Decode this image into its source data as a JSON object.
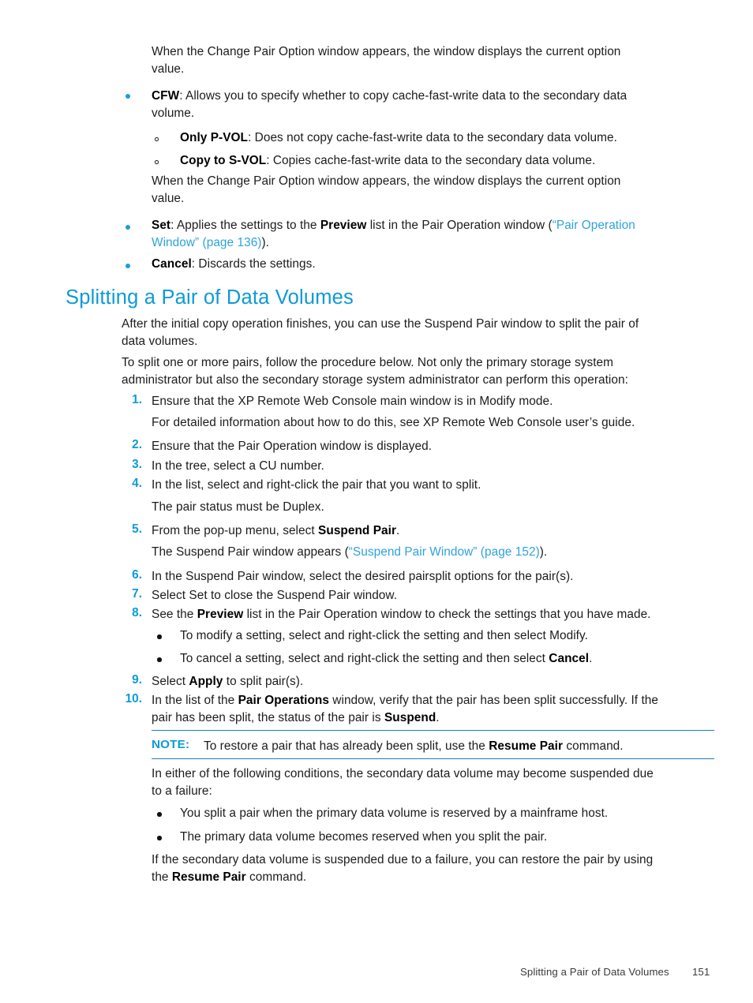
{
  "page": {
    "number": "151",
    "footer_title": "Splitting a Pair of Data Volumes"
  },
  "intro": {
    "para1_line1": "When the Change Pair Option window appears, the window displays the current option",
    "para1_line2": "value."
  },
  "option_bullets": [
    {
      "term": "CFW",
      "rest_line1": ": Allows you to specify whether to copy cache-fast-write data to the secondary data",
      "rest_line2": "volume."
    }
  ],
  "sub_bullets": [
    {
      "term": "Only P-VOL",
      "rest": ": Does not copy cache-fast-write data to the secondary data volume."
    },
    {
      "term": "Copy to S-VOL",
      "rest": ": Copies cache-fast-write data to the secondary data volume."
    }
  ],
  "intro2": {
    "line1": "When the Change Pair Option window appears, the window displays the current option",
    "line2": "value."
  },
  "set_bullet": {
    "term": "Set",
    "part1": ": Applies the settings to the ",
    "bold2": "Preview",
    "part2": " list in the Pair Operation window (",
    "link_line1": "“Pair Operation",
    "link_line2": "Window” (page 136)",
    "tail": ")."
  },
  "cancel_bullet": {
    "term": "Cancel",
    "rest": ": Discards the settings."
  },
  "heading": "Splitting a Pair of Data Volumes",
  "section_intro": {
    "p1_line1": "After the initial copy operation finishes, you can use the Suspend Pair window to split the pair of",
    "p1_line2": "data volumes.",
    "p2_line1": "To split one or more pairs, follow the procedure below. Not only the primary storage system",
    "p2_line2": "administrator but also the secondary storage system administrator can perform this operation:"
  },
  "steps": [
    {
      "num": "1.",
      "text": "Ensure that the XP Remote Web Console main window is in Modify mode.",
      "sub_text": "For detailed information about how to do this, see XP Remote Web Console user’s guide."
    },
    {
      "num": "2.",
      "text": "Ensure that the Pair Operation window is displayed."
    },
    {
      "num": "3.",
      "text": "In the tree, select a CU number."
    },
    {
      "num": "4.",
      "text": "In the list, select and right-click the pair that you want to split.",
      "sub_text": "The pair status must be Duplex."
    },
    {
      "num": "5.",
      "text_pre": "From the pop-up menu, select ",
      "text_bold": "Suspend Pair",
      "text_post": ".",
      "sub_pre": "The Suspend Pair window appears (",
      "sub_link": "“Suspend Pair Window” (page 152)",
      "sub_post": ")."
    },
    {
      "num": "6.",
      "text": "In the Suspend Pair window, select the desired pairsplit options for the pair(s)."
    },
    {
      "num": "7.",
      "text": "Select Set to close the Suspend Pair window."
    },
    {
      "num": "8.",
      "text_pre": "See the ",
      "text_bold": "Preview",
      "text_post": " list in the Pair Operation window to check the settings that you have made."
    },
    {
      "num": "9.",
      "text_pre": "Select ",
      "text_bold": "Apply",
      "text_post": " to split pair(s)."
    },
    {
      "num": "10.",
      "line1_pre": "In the list of the ",
      "line1_bold": "Pair Operations",
      "line1_post": " window, verify that the pair has been split successfully. If the",
      "line2_pre": "pair has been split, the status of the pair is ",
      "line2_bold": "Suspend",
      "line2_post": "."
    }
  ],
  "step8_bullets": [
    {
      "text": "To modify a setting, select and right-click the setting and then select Modify."
    },
    {
      "text_pre": "To cancel a setting, select and right-click the setting and then select ",
      "text_bold": "Cancel",
      "text_post": "."
    }
  ],
  "note": {
    "label": "NOTE:",
    "text_pre": "To restore a pair that has already been split, use the ",
    "text_bold": "Resume Pair",
    "text_post": " command."
  },
  "closing": {
    "p1_line1": "In either of the following conditions, the secondary data volume may become suspended due",
    "p1_line2": "to a failure:",
    "bullets": [
      "You split a pair when the primary data volume is reserved by a mainframe host.",
      "The primary data volume becomes reserved when you split the pair."
    ],
    "p2_line1": "If the secondary data volume is suspended due to a failure, you can restore the pair by using",
    "p2_pre": "the ",
    "p2_bold": "Resume Pair",
    "p2_post": " command."
  }
}
